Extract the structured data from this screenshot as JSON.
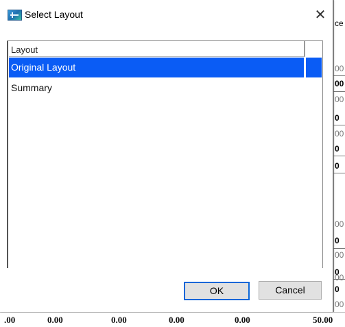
{
  "dialog": {
    "title": "Select Layout",
    "close_glyph": "✕",
    "icon": "app-icon"
  },
  "list": {
    "column_header": "Layout",
    "items": [
      {
        "label": "Original Layout",
        "selected": true
      },
      {
        "label": "Summary",
        "selected": false
      }
    ]
  },
  "buttons": {
    "ok": "OK",
    "cancel": "Cancel"
  },
  "background": {
    "right_header": "ce",
    "right_values": [
      "00",
      "00",
      "00",
      "0",
      "00",
      "0",
      "0",
      "00",
      "0",
      "00",
      "0",
      "00",
      "0",
      "00"
    ],
    "bottom_values": [
      ".00",
      "0.00",
      "0.00",
      "0.00",
      "0.00",
      "50.00"
    ]
  },
  "colors": {
    "selection": "#0a5cf5",
    "default_button_border": "#0a66d8",
    "button_face": "#e1e1e1"
  }
}
